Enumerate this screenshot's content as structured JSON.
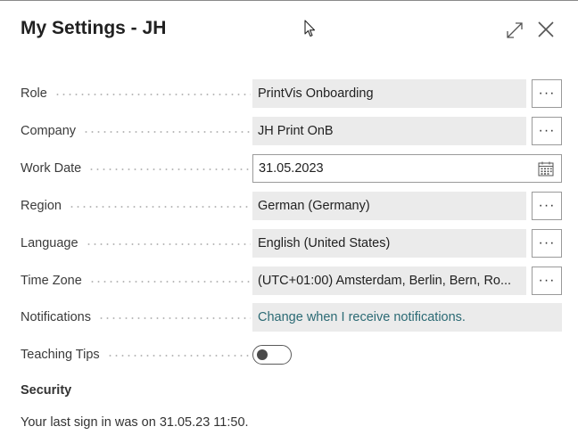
{
  "dialog": {
    "title": "My Settings - JH"
  },
  "fields": {
    "role": {
      "label": "Role",
      "value": "PrintVis Onboarding",
      "lookup": "···"
    },
    "company": {
      "label": "Company",
      "value": "JH Print OnB",
      "lookup": "···"
    },
    "work_date": {
      "label": "Work Date",
      "value": "31.05.2023"
    },
    "region": {
      "label": "Region",
      "value": "German (Germany)",
      "lookup": "···"
    },
    "language": {
      "label": "Language",
      "value": "English (United States)",
      "lookup": "···"
    },
    "time_zone": {
      "label": "Time Zone",
      "value": "(UTC+01:00) Amsterdam, Berlin, Bern, Ro...",
      "lookup": "···"
    },
    "notifications": {
      "label": "Notifications",
      "value": "Change when I receive notifications."
    },
    "teaching_tips": {
      "label": "Teaching Tips",
      "enabled": false
    }
  },
  "security": {
    "heading": "Security",
    "last_sign_in": "Your last sign in was on 31.05.23 11:50."
  },
  "icons": {
    "expand": "expand-icon",
    "close": "close-icon",
    "calendar": "calendar-icon",
    "cursor": "mouse-pointer-icon"
  }
}
